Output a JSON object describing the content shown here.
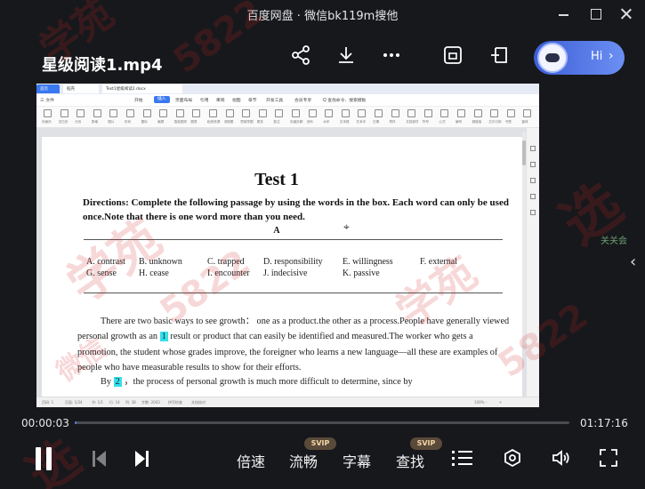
{
  "window": {
    "title": "百度网盘 · 微信bk119m搜他"
  },
  "header": {
    "video_title": "星级阅读1.mp4",
    "assistant_label": "Hi",
    "assistant_chevron": "›"
  },
  "side": {
    "arrow": "‹",
    "note": "关关会"
  },
  "wps": {
    "tab_home": "首页",
    "tab_1": "稻壳",
    "tab_2": "Test1星级阅读2.docx",
    "menu": [
      "三 文件",
      "开始",
      "插入",
      "页面布局",
      "引用",
      "审阅",
      "视图",
      "章节",
      "开发工具",
      "会员专享",
      "Q 查找命令、搜索模板"
    ],
    "menu_active": "插入",
    "toolbar": [
      "封面页",
      "空白页",
      "分页",
      "表格",
      "图片",
      "形状",
      "图标",
      "截屏",
      "智能图形",
      "图表",
      "稻壳资源",
      "流程图",
      "思维导图",
      "更多",
      "批注",
      "页眉页脚",
      "页码",
      "水印",
      "文本框",
      "艺术字",
      "日期",
      "附件",
      "文档部件",
      "符号",
      "公式",
      "编号",
      "超链接",
      "交叉引用",
      "书签",
      "窗体"
    ],
    "status": [
      "页码: 1",
      "页面: 1/34",
      "节: 1/1",
      "行: 14",
      "列: 38",
      "字数: 2003",
      "拼写检查",
      "文档校对",
      "100% -",
      "+"
    ]
  },
  "document": {
    "title": "Test 1",
    "directions": "Directions: Complete the following passage by using the words in the box. Each word can only be used once.Note that there is one word more than you need.",
    "section": "A",
    "options_row1": [
      "A. contrast",
      "B. unknown",
      "C. trapped",
      "D. responsibility",
      "E. willingness",
      "F. external"
    ],
    "options_row2": [
      "G. sense",
      "H. cease",
      "I. encounter",
      "J. indecisive",
      "K. passive"
    ],
    "para1_a": "There are two basic ways to see growth： one as a product.the other as a process.People have generally viewed personal growth as an ",
    "blank1": "1",
    "para1_b": " result or product that can easily be identified and measured.The worker who gets a promotion, the student whose grades improve, the foreigner who learns a new language—all these are examples of people who have measurable results to show for their efforts.",
    "para2_a": "By ",
    "blank2": "2",
    "para2_b": "       ，the process of personal growth is much more difficult to determine, since by"
  },
  "player": {
    "current_time": "00:00:03",
    "total_time": "01:17:16",
    "progress_fraction": 0.0007,
    "speed_label": "倍速",
    "quality_label": "流畅",
    "subtitle_label": "字幕",
    "search_label": "查找",
    "svip_badge": "SVIP"
  },
  "watermark": {
    "text_1": "学苑",
    "text_2": "选",
    "text_3": "5822",
    "text_4": "微信",
    "text_5": "学苑"
  },
  "colors": {
    "background": "#17181c",
    "accent": "#5b7cff",
    "highlight": "#34e0ea"
  }
}
